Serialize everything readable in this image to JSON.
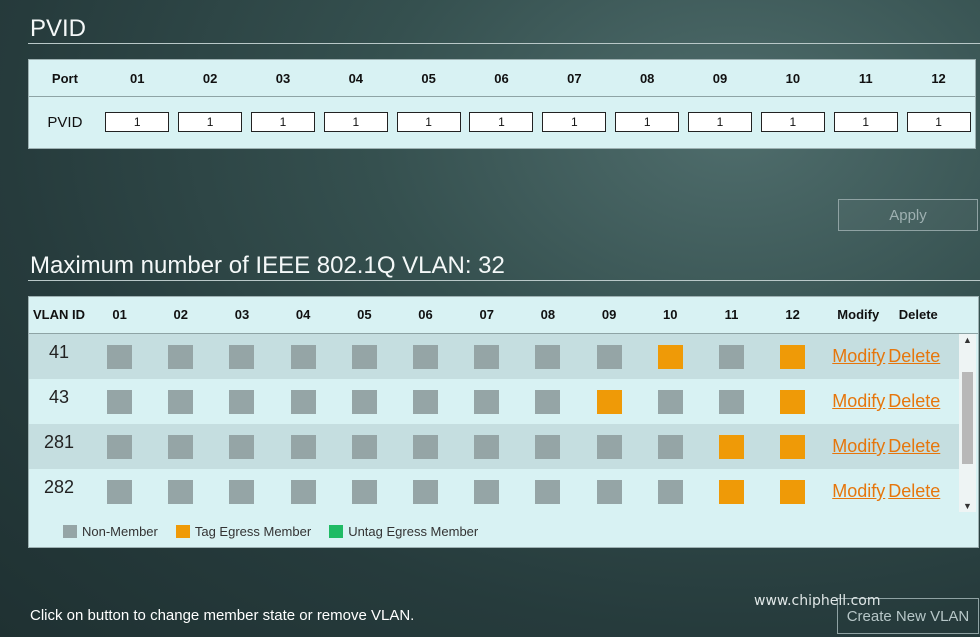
{
  "pvid_section": {
    "title": "PVID",
    "row_header": "Port",
    "row_label": "PVID",
    "ports": [
      "01",
      "02",
      "03",
      "04",
      "05",
      "06",
      "07",
      "08",
      "09",
      "10",
      "11",
      "12"
    ],
    "values": [
      "1",
      "1",
      "1",
      "1",
      "1",
      "1",
      "1",
      "1",
      "1",
      "1",
      "1",
      "1"
    ],
    "apply_label": "Apply"
  },
  "vlan_section": {
    "title": "Maximum number of IEEE 802.1Q VLAN: 32",
    "columns": {
      "vlan_id": "VLAN ID",
      "ports": [
        "01",
        "02",
        "03",
        "04",
        "05",
        "06",
        "07",
        "08",
        "09",
        "10",
        "11",
        "12"
      ],
      "modify": "Modify",
      "delete": "Delete"
    },
    "rows": [
      {
        "id": "41",
        "members": [
          "n",
          "n",
          "n",
          "n",
          "n",
          "n",
          "n",
          "n",
          "n",
          "t",
          "n",
          "t"
        ],
        "modify": "Modify",
        "delete": "Delete"
      },
      {
        "id": "43",
        "members": [
          "n",
          "n",
          "n",
          "n",
          "n",
          "n",
          "n",
          "n",
          "t",
          "n",
          "n",
          "t"
        ],
        "modify": "Modify",
        "delete": "Delete"
      },
      {
        "id": "281",
        "members": [
          "n",
          "n",
          "n",
          "n",
          "n",
          "n",
          "n",
          "n",
          "n",
          "n",
          "t",
          "t"
        ],
        "modify": "Modify",
        "delete": "Delete"
      },
      {
        "id": "282",
        "members": [
          "n",
          "n",
          "n",
          "n",
          "n",
          "n",
          "n",
          "n",
          "n",
          "n",
          "t",
          "t"
        ],
        "modify": "Modify",
        "delete": "Delete"
      }
    ],
    "legend": [
      {
        "key": "n",
        "label": "Non-Member",
        "color": "#95a5a6"
      },
      {
        "key": "t",
        "label": "Tag Egress Member",
        "color": "#ef9a07"
      },
      {
        "key": "u",
        "label": "Untag Egress Member",
        "color": "#1fbb64"
      }
    ]
  },
  "footer_text": "Click on button to change member state or remove VLAN.",
  "create_label": "Create New VLAN",
  "watermark_url": "www.chiphell.com"
}
